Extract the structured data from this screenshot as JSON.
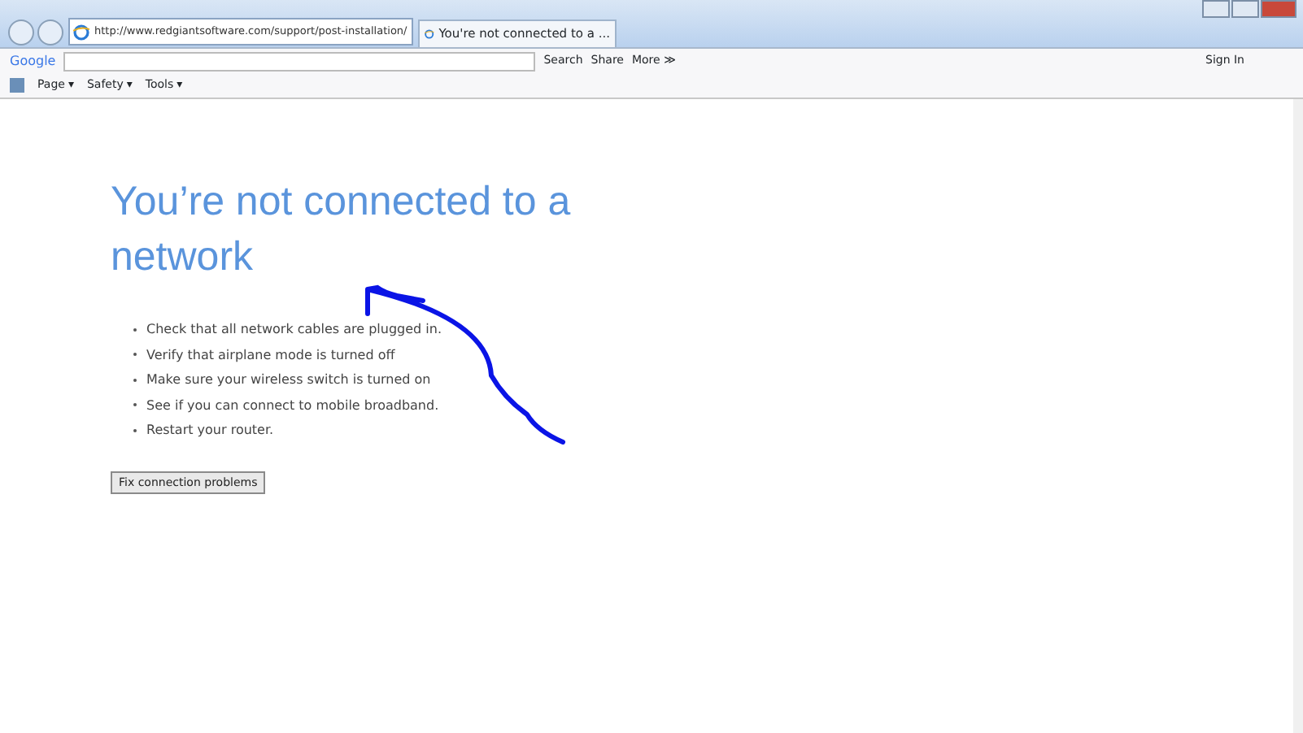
{
  "address_bar": {
    "url": "http://www.redgiantsoftware.com/support/post-installation/"
  },
  "tab": {
    "title": "You're not connected to a ...",
    "selected": true
  },
  "google_toolbar": {
    "logo": "Google",
    "search": "Search",
    "share": "Share",
    "more": "More ≫",
    "sign_in": "Sign In"
  },
  "command_bar": [
    {
      "label": "Page",
      "caret": "▾"
    },
    {
      "label": "Safety",
      "caret": "▾"
    },
    {
      "label": "Tools",
      "caret": "▾"
    }
  ],
  "page": {
    "heading": "You’re not connected to a network",
    "tips": [
      "Check that all network cables are plugged in.",
      "Verify that airplane mode is turned off",
      "Make sure your wireless switch is turned on",
      "See if you can connect to mobile broadband.",
      "Restart your router."
    ],
    "button": "Fix connection problems"
  }
}
